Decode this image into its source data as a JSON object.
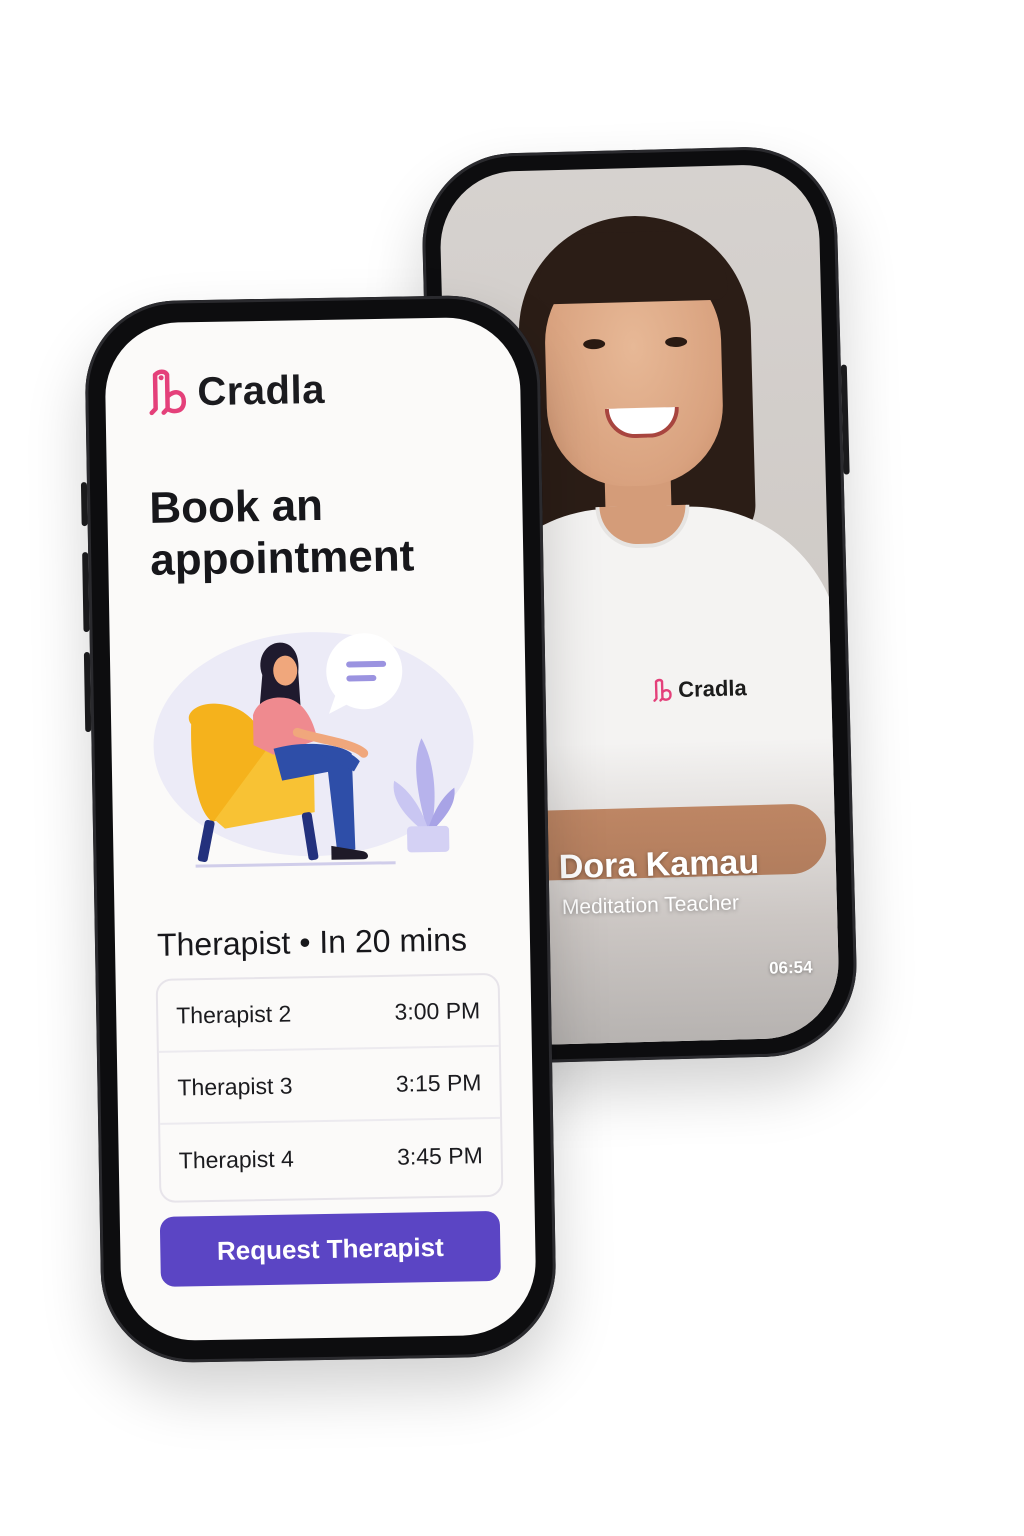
{
  "brand": {
    "name": "Cradla",
    "accent_color": "#e4407a",
    "primary_color": "#5b45c4"
  },
  "video_call": {
    "caller_name": "Dora Kamau",
    "caller_role": "Meditation Teacher",
    "timer": "06:54",
    "shirt_logo": "Cradla"
  },
  "booking": {
    "title": "Book an appointment",
    "section_title": "Therapist • In 20 mins",
    "slots": [
      {
        "name": "Therapist 2",
        "time": "3:00 PM"
      },
      {
        "name": "Therapist 3",
        "time": "3:15 PM"
      },
      {
        "name": "Therapist 4",
        "time": "3:45 PM"
      }
    ],
    "cta_label": "Request Therapist"
  }
}
